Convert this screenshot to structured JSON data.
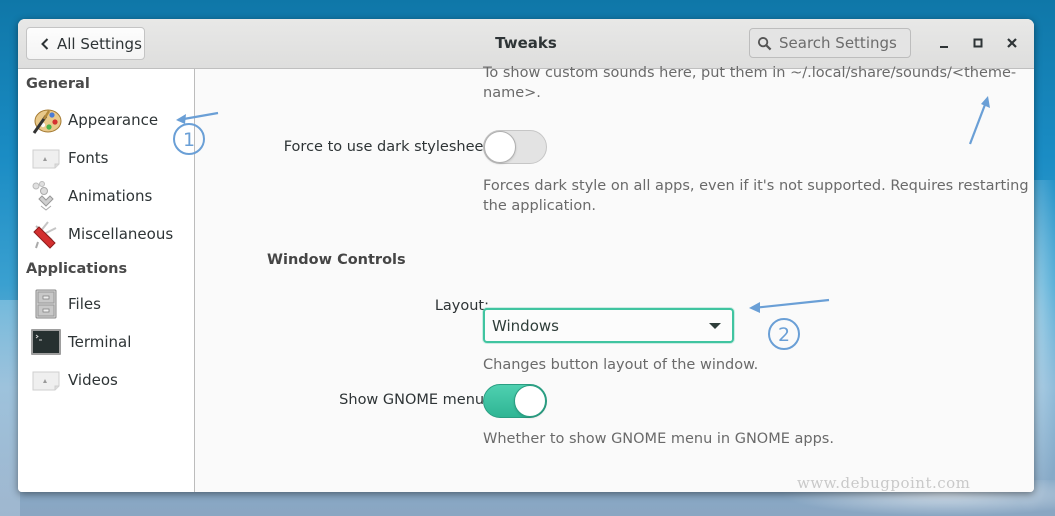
{
  "window": {
    "title": "Tweaks",
    "back_button_label": "All Settings",
    "search_placeholder": "Search Settings",
    "controls": [
      "minimize",
      "maximize",
      "close"
    ]
  },
  "sidebar": {
    "sections": [
      {
        "heading": "General",
        "items": [
          {
            "label": "Appearance",
            "icon": "palette-icon"
          },
          {
            "label": "Fonts",
            "icon": "fonts-icon"
          },
          {
            "label": "Animations",
            "icon": "animations-icon"
          },
          {
            "label": "Miscellaneous",
            "icon": "swiss-knife-icon"
          }
        ]
      },
      {
        "heading": "Applications",
        "items": [
          {
            "label": "Files",
            "icon": "file-cabinet-icon"
          },
          {
            "label": "Terminal",
            "icon": "terminal-icon"
          },
          {
            "label": "Videos",
            "icon": "videos-icon"
          }
        ]
      }
    ]
  },
  "content": {
    "sounds_desc_line1": "To show custom sounds here, put them in ~/.local/share/sounds/<theme-",
    "sounds_desc_line2": "name>.",
    "dark_stylesheet": {
      "label": "Force to use dark stylesheet:",
      "enabled": false,
      "desc_line1": "Forces dark style on all apps, even if it's not supported. Requires restarting",
      "desc_line2": "the application."
    },
    "window_controls": {
      "section_title": "Window Controls",
      "layout_label": "Layout:",
      "layout_value": "Windows",
      "layout_desc": "Changes button layout of the window."
    },
    "gnome_menu": {
      "label": "Show GNOME menu:",
      "enabled": true,
      "desc": "Whether to show GNOME menu in GNOME apps."
    }
  },
  "annotations": {
    "marker_1": "1",
    "marker_2": "2",
    "watermark": "www.debugpoint.com"
  },
  "colors": {
    "accent": "#3cc29f",
    "annotation": "#6a9fd6"
  }
}
